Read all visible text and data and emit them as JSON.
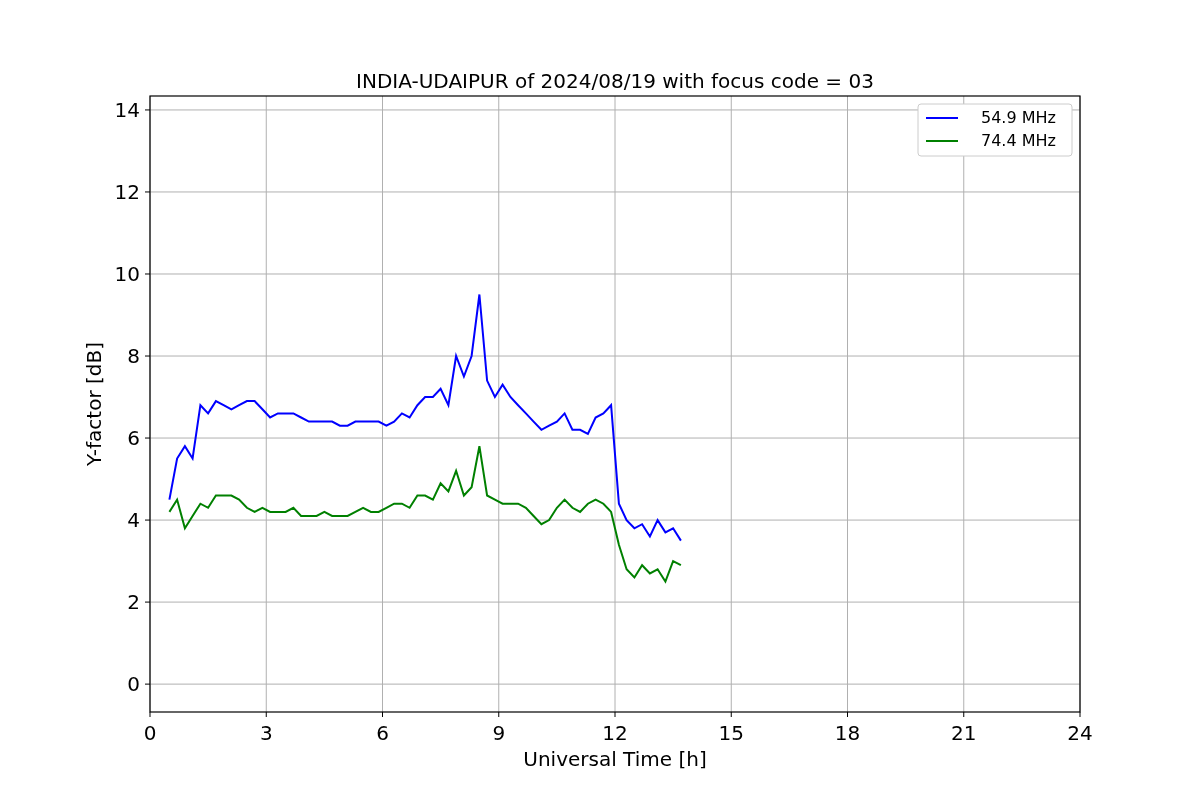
{
  "figure": {
    "chart_data": {
      "type": "line",
      "title": "INDIA-UDAIPUR of 2024/08/19 with focus code = 03",
      "xlabel": "Universal Time [h]",
      "ylabel": "Y-factor [dB]",
      "xlim": [
        0,
        24
      ],
      "ylim": [
        -0.68,
        14.34
      ],
      "xticks": [
        0,
        3,
        6,
        9,
        12,
        15,
        18,
        21,
        24
      ],
      "grid": true,
      "legend": true,
      "yticks": [
        0,
        2,
        4,
        6,
        8,
        10,
        12,
        14
      ],
      "x": [
        0.5,
        0.7,
        0.9,
        1.1,
        1.3,
        1.5,
        1.7,
        1.9,
        2.1,
        2.3,
        2.5,
        2.7,
        2.9,
        3.1,
        3.3,
        3.5,
        3.7,
        3.9,
        4.1,
        4.3,
        4.5,
        4.7,
        4.9,
        5.1,
        5.3,
        5.5,
        5.7,
        5.9,
        6.1,
        6.3,
        6.5,
        6.7,
        6.9,
        7.1,
        7.3,
        7.5,
        7.7,
        7.9,
        8.1,
        8.3,
        8.5,
        8.7,
        8.9,
        9.1,
        9.3,
        9.5,
        9.7,
        9.9,
        10.1,
        10.3,
        10.5,
        10.7,
        10.9,
        11.1,
        11.3,
        11.5,
        11.7,
        11.9,
        12.1,
        12.3,
        12.5,
        12.7,
        12.9,
        13.1,
        13.3,
        13.5,
        13.7
      ],
      "series": [
        {
          "name": "54.9 MHz",
          "color": "#0000ff",
          "values": [
            4.5,
            5.5,
            5.8,
            5.5,
            6.8,
            6.6,
            6.9,
            6.8,
            6.7,
            6.8,
            6.9,
            6.9,
            6.7,
            6.5,
            6.6,
            6.6,
            6.6,
            6.5,
            6.4,
            6.4,
            6.4,
            6.4,
            6.3,
            6.3,
            6.4,
            6.4,
            6.4,
            6.4,
            6.3,
            6.4,
            6.6,
            6.5,
            6.8,
            7.0,
            7.0,
            7.2,
            6.8,
            8.0,
            7.5,
            8.0,
            9.5,
            7.4,
            7.0,
            7.3,
            7.0,
            6.8,
            6.6,
            6.4,
            6.2,
            6.3,
            6.4,
            6.6,
            6.2,
            6.2,
            6.1,
            6.5,
            6.6,
            6.8,
            4.4,
            4.0,
            3.8,
            3.9,
            3.6,
            4.0,
            3.7,
            3.8,
            3.5
          ]
        },
        {
          "name": "74.4 MHz",
          "color": "#008000",
          "values": [
            4.2,
            4.5,
            3.8,
            4.1,
            4.4,
            4.3,
            4.6,
            4.6,
            4.6,
            4.5,
            4.3,
            4.2,
            4.3,
            4.2,
            4.2,
            4.2,
            4.3,
            4.1,
            4.1,
            4.1,
            4.2,
            4.1,
            4.1,
            4.1,
            4.2,
            4.3,
            4.2,
            4.2,
            4.3,
            4.4,
            4.4,
            4.3,
            4.6,
            4.6,
            4.5,
            4.9,
            4.7,
            5.2,
            4.6,
            4.8,
            5.8,
            4.6,
            4.5,
            4.4,
            4.4,
            4.4,
            4.3,
            4.1,
            3.9,
            4.0,
            4.3,
            4.5,
            4.3,
            4.2,
            4.4,
            4.5,
            4.4,
            4.2,
            3.4,
            2.8,
            2.6,
            2.9,
            2.7,
            2.8,
            2.5,
            3.0,
            2.9
          ]
        }
      ]
    }
  }
}
